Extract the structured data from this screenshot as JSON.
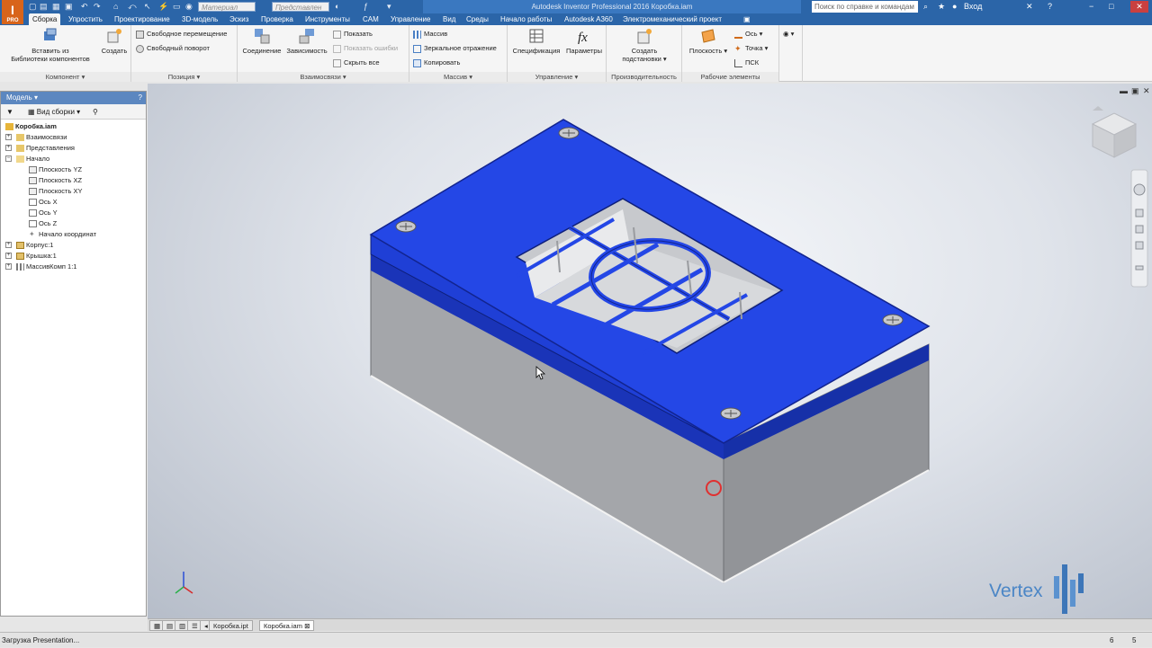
{
  "app": {
    "logo_text": "I",
    "logo_sub": "PRO",
    "title": "Autodesk Inventor Professional 2016   Коробка.iam",
    "search_placeholder": "Поиск по справке и командам",
    "signin": "Вход",
    "material_combo": "Материал",
    "appearance_combo": "Представлен"
  },
  "tabs": [
    "Сборка",
    "Упростить",
    "Проектирование",
    "3D-модель",
    "Эскиз",
    "Проверка",
    "Инструменты",
    "CAM",
    "Управление",
    "Вид",
    "Среды",
    "Начало работы",
    "Autodesk A360",
    "Электромеханический проект"
  ],
  "ribbon": {
    "component": {
      "label": "Компонент",
      "insert": "Вставить из\nБиблиотеки компонентов",
      "create": "Создать"
    },
    "position": {
      "label": "Позиция",
      "free_move": "Свободное перемещение",
      "free_rotate": "Свободный поворот"
    },
    "relations": {
      "label": "Взаимосвязи",
      "joint": "Соединение",
      "constrain": "Зависимость",
      "show": "Показать",
      "show_errors": "Показать ошибки",
      "hide_all": "Скрыть все"
    },
    "pattern": {
      "label": "Массив",
      "pattern": "Массив",
      "mirror": "Зеркальное отражение",
      "copy": "Копировать"
    },
    "manage": {
      "label": "Управление",
      "bom": "Спецификация",
      "params": "Параметры"
    },
    "productivity": {
      "label": "Производительность",
      "create_sub": "Создать\nподстановки"
    },
    "work_features": {
      "label": "Рабочие элементы",
      "plane": "Плоскость",
      "axis": "Ось",
      "point": "Точка",
      "ucs": "ПСК"
    }
  },
  "browser": {
    "title": "Модель",
    "view_label": "Вид сборки",
    "tree": [
      "Коробка.iam",
      "Взаимосвязи",
      "Представления",
      "Начало",
      "Плоскость YZ",
      "Плоскость XZ",
      "Плоскость XY",
      "Ось X",
      "Ось Y",
      "Ось Z",
      "Начало координат",
      "Корпус:1",
      "Крышка:1",
      "МассивКомп 1:1"
    ]
  },
  "doc_tabs": [
    "Коробка.ipt",
    "Коробка.iam"
  ],
  "status": {
    "text": "Загрузка Presentation...",
    "n1": "6",
    "n2": "5"
  },
  "watermark": "Vertex",
  "colors": {
    "lid": "#1f3fd6",
    "body": "#a9aaad",
    "titlebar": "#2b65a8"
  }
}
